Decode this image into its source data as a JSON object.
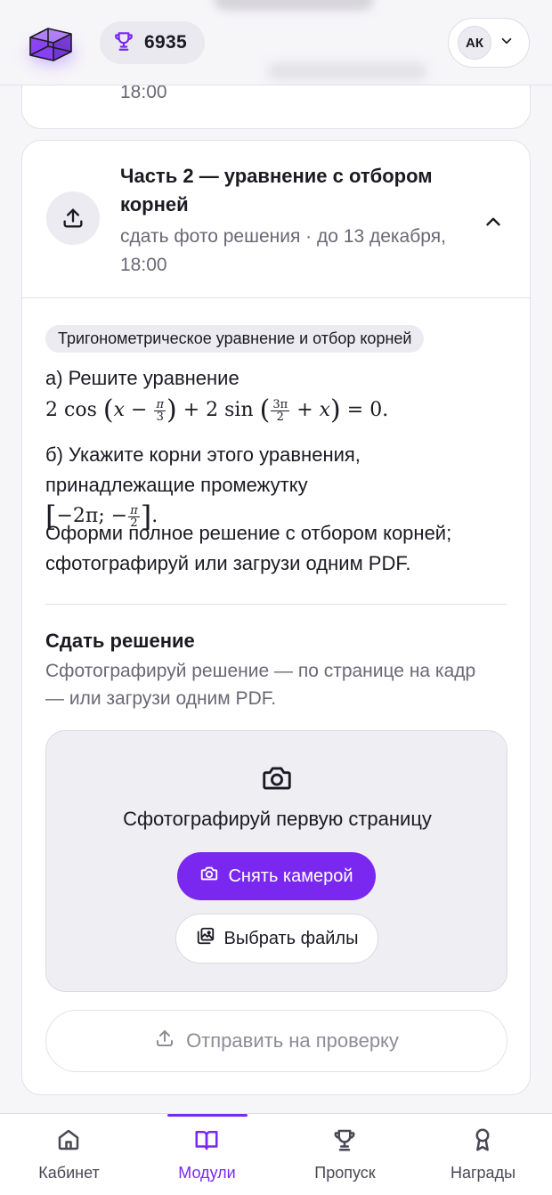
{
  "header": {
    "score": "6935",
    "user_initials": "АК",
    "logo_icon": "cube-logo-icon",
    "trophy_icon": "trophy-icon"
  },
  "prev_task": {
    "time": "18:00"
  },
  "task": {
    "title": "Часть 2 — уравнение с отбором корней",
    "subtitle": "сдать фото решения · до 13 декабря, 18:00",
    "chip": "Тригонометрическое уравнение и отбор корней",
    "part_a_label": "а) Решите уравнение",
    "equation": {
      "lead_coef": "2",
      "cos": "cos",
      "var": "x",
      "minus": "−",
      "pi": "π",
      "three": "3",
      "plus_two": "+ 2",
      "sin": "sin",
      "three_pi": "3π",
      "two": "2",
      "plus": "+",
      "equals_zero": "= 0."
    },
    "part_b_label": "б) Укажите корни этого уравнения, принадлежащие промежутку",
    "interval": {
      "left": "−2π;",
      "minus": "−",
      "pi": "π",
      "two": "2",
      "dot": "."
    },
    "instruction": "Оформи полное решение с отбором корней; сфотографируй или загрузи одним PDF."
  },
  "submit": {
    "title": "Сдать решение",
    "description": "Сфотографируй решение — по странице на кадр — или загрузи одним PDF.",
    "dropzone_text": "Сфотографируй первую страницу",
    "camera_button": "Снять камерой",
    "files_button": "Выбрать файлы",
    "send_button": "Отправить на проверку"
  },
  "nav": {
    "items": [
      {
        "label": "Кабинет",
        "icon": "home-icon"
      },
      {
        "label": "Модули",
        "icon": "book-icon"
      },
      {
        "label": "Пропуск",
        "icon": "trophy-icon"
      },
      {
        "label": "Награды",
        "icon": "award-icon"
      }
    ],
    "active_index": 1
  },
  "colors": {
    "accent": "#7a28f0",
    "background": "#f6f5f8",
    "muted_text": "#6b6875"
  }
}
